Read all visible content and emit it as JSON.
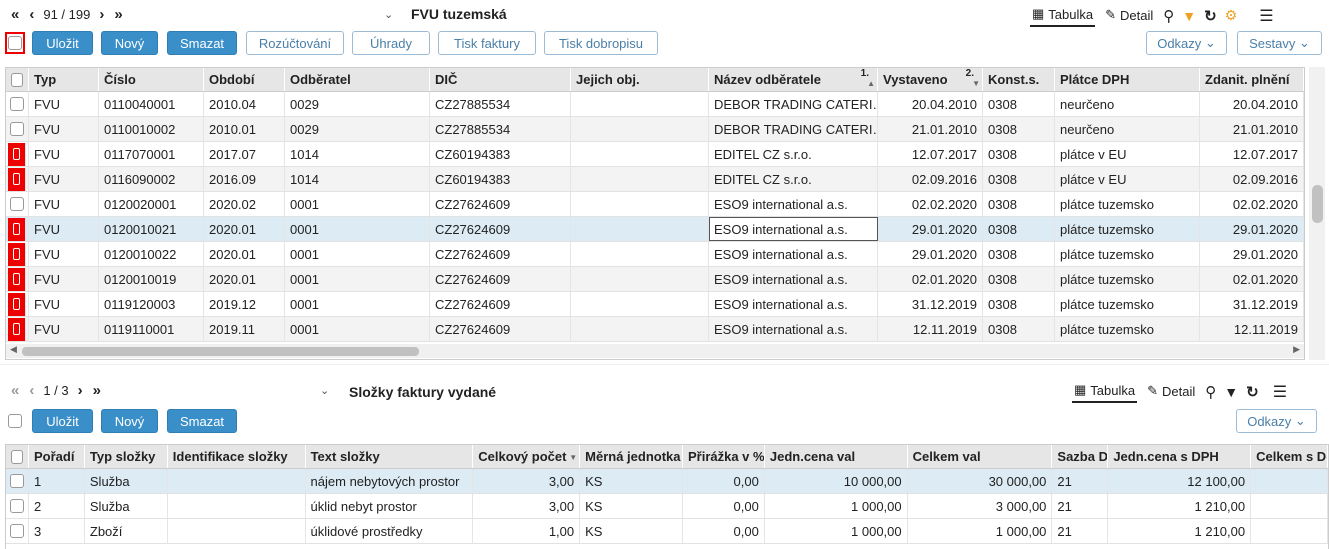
{
  "top": {
    "page_text": "91 / 199",
    "title": "FVU tuzemská",
    "tab_table": "Tabulka",
    "tab_detail": "Detail",
    "buttons": {
      "save": "Uložit",
      "new": "Nový",
      "delete": "Smazat",
      "allocation": "Rozúčtování",
      "payments": "Úhrady",
      "print_invoice": "Tisk faktury",
      "print_credit": "Tisk dobropisu",
      "links": "Odkazy",
      "reports": "Sestavy"
    },
    "columns": [
      "Typ",
      "Číslo",
      "Období",
      "Odběratel",
      "DIČ",
      "Jejich obj.",
      "Název odběratele",
      "Vystaveno",
      "Konst.s.",
      "Plátce DPH",
      "Zdanit. plnění"
    ],
    "sort_marks": {
      "name": "1.",
      "issued": "2."
    },
    "rows": [
      {
        "mark": "none",
        "typ": "FVU",
        "cislo": "0110040001",
        "obdobi": "2010.04",
        "odberatel": "0029",
        "dic": "CZ27885534",
        "obj": "",
        "nazev": "DEBOR TRADING CATERI…",
        "vystaveno": "20.04.2010",
        "konst": "0308",
        "platce": "neurčeno",
        "zdanit": "20.04.2010"
      },
      {
        "mark": "none",
        "typ": "FVU",
        "cislo": "0110010002",
        "obdobi": "2010.01",
        "odberatel": "0029",
        "dic": "CZ27885534",
        "obj": "",
        "nazev": "DEBOR TRADING CATERI…",
        "vystaveno": "21.01.2010",
        "konst": "0308",
        "platce": "neurčeno",
        "zdanit": "21.01.2010"
      },
      {
        "mark": "red",
        "typ": "FVU",
        "cislo": "0117070001",
        "obdobi": "2017.07",
        "odberatel": "1014",
        "dic": "CZ60194383",
        "obj": "",
        "nazev": "EDITEL CZ s.r.o.",
        "vystaveno": "12.07.2017",
        "konst": "0308",
        "platce": "plátce v EU",
        "zdanit": "12.07.2017"
      },
      {
        "mark": "red",
        "typ": "FVU",
        "cislo": "0116090002",
        "obdobi": "2016.09",
        "odberatel": "1014",
        "dic": "CZ60194383",
        "obj": "",
        "nazev": "EDITEL CZ s.r.o.",
        "vystaveno": "02.09.2016",
        "konst": "0308",
        "platce": "plátce v EU",
        "zdanit": "02.09.2016"
      },
      {
        "mark": "none",
        "typ": "FVU",
        "cislo": "0120020001",
        "obdobi": "2020.02",
        "odberatel": "0001",
        "dic": "CZ27624609",
        "obj": "",
        "nazev": "ESO9 international a.s.",
        "vystaveno": "02.02.2020",
        "konst": "0308",
        "platce": "plátce tuzemsko",
        "zdanit": "02.02.2020"
      },
      {
        "mark": "red",
        "typ": "FVU",
        "cislo": "0120010021",
        "obdobi": "2020.01",
        "odberatel": "0001",
        "dic": "CZ27624609",
        "obj": "",
        "nazev": "ESO9 international a.s.",
        "vystaveno": "29.01.2020",
        "konst": "0308",
        "platce": "plátce tuzemsko",
        "zdanit": "29.01.2020"
      },
      {
        "mark": "red",
        "typ": "FVU",
        "cislo": "0120010022",
        "obdobi": "2020.01",
        "odberatel": "0001",
        "dic": "CZ27624609",
        "obj": "",
        "nazev": "ESO9 international a.s.",
        "vystaveno": "29.01.2020",
        "konst": "0308",
        "platce": "plátce tuzemsko",
        "zdanit": "29.01.2020"
      },
      {
        "mark": "red",
        "typ": "FVU",
        "cislo": "0120010019",
        "obdobi": "2020.01",
        "odberatel": "0001",
        "dic": "CZ27624609",
        "obj": "",
        "nazev": "ESO9 international a.s.",
        "vystaveno": "02.01.2020",
        "konst": "0308",
        "platce": "plátce tuzemsko",
        "zdanit": "02.01.2020"
      },
      {
        "mark": "red",
        "typ": "FVU",
        "cislo": "0119120003",
        "obdobi": "2019.12",
        "odberatel": "0001",
        "dic": "CZ27624609",
        "obj": "",
        "nazev": "ESO9 international a.s.",
        "vystaveno": "31.12.2019",
        "konst": "0308",
        "platce": "plátce tuzemsko",
        "zdanit": "31.12.2019"
      },
      {
        "mark": "red",
        "typ": "FVU",
        "cislo": "0119110001",
        "obdobi": "2019.11",
        "odberatel": "0001",
        "dic": "CZ27624609",
        "obj": "",
        "nazev": "ESO9 international a.s.",
        "vystaveno": "12.11.2019",
        "konst": "0308",
        "platce": "plátce tuzemsko",
        "zdanit": "12.11.2019"
      }
    ]
  },
  "bottom": {
    "page_text": "1 / 3",
    "title": "Složky faktury vydané",
    "tab_table": "Tabulka",
    "tab_detail": "Detail",
    "buttons": {
      "save": "Uložit",
      "new": "Nový",
      "delete": "Smazat",
      "links": "Odkazy"
    },
    "columns": [
      "Pořadí",
      "Typ složky",
      "Identifikace složky",
      "Text složky",
      "Celkový počet",
      "Měrná jednotka",
      "Přirážka v %",
      "Jedn.cena val",
      "Celkem val",
      "Sazba D",
      "Jedn.cena s DPH",
      "Celkem s D"
    ],
    "rows": [
      {
        "poradi": "1",
        "typ": "Služba",
        "ident": "",
        "text": "nájem nebytových prostor",
        "pocet": "3,00",
        "mj": "KS",
        "prir": "0,00",
        "cena": "10 000,00",
        "celkem": "30 000,00",
        "sazba": "21",
        "cenadph": "12 100,00",
        "celkemd": ""
      },
      {
        "poradi": "2",
        "typ": "Služba",
        "ident": "",
        "text": "úklid nebyt prostor",
        "pocet": "3,00",
        "mj": "KS",
        "prir": "0,00",
        "cena": "1 000,00",
        "celkem": "3 000,00",
        "sazba": "21",
        "cenadph": "1 210,00",
        "celkemd": ""
      },
      {
        "poradi": "3",
        "typ": "Zboží",
        "ident": "",
        "text": "úklidové prostředky",
        "pocet": "1,00",
        "mj": "KS",
        "prir": "0,00",
        "cena": "1 000,00",
        "celkem": "1 000,00",
        "sazba": "21",
        "cenadph": "1 210,00",
        "celkemd": ""
      }
    ]
  },
  "colors": {
    "primary": "#3a8fc9",
    "mark_red": "#ee0000",
    "selected_row": "#dcebf4",
    "filter_orange": "#f0a020"
  }
}
